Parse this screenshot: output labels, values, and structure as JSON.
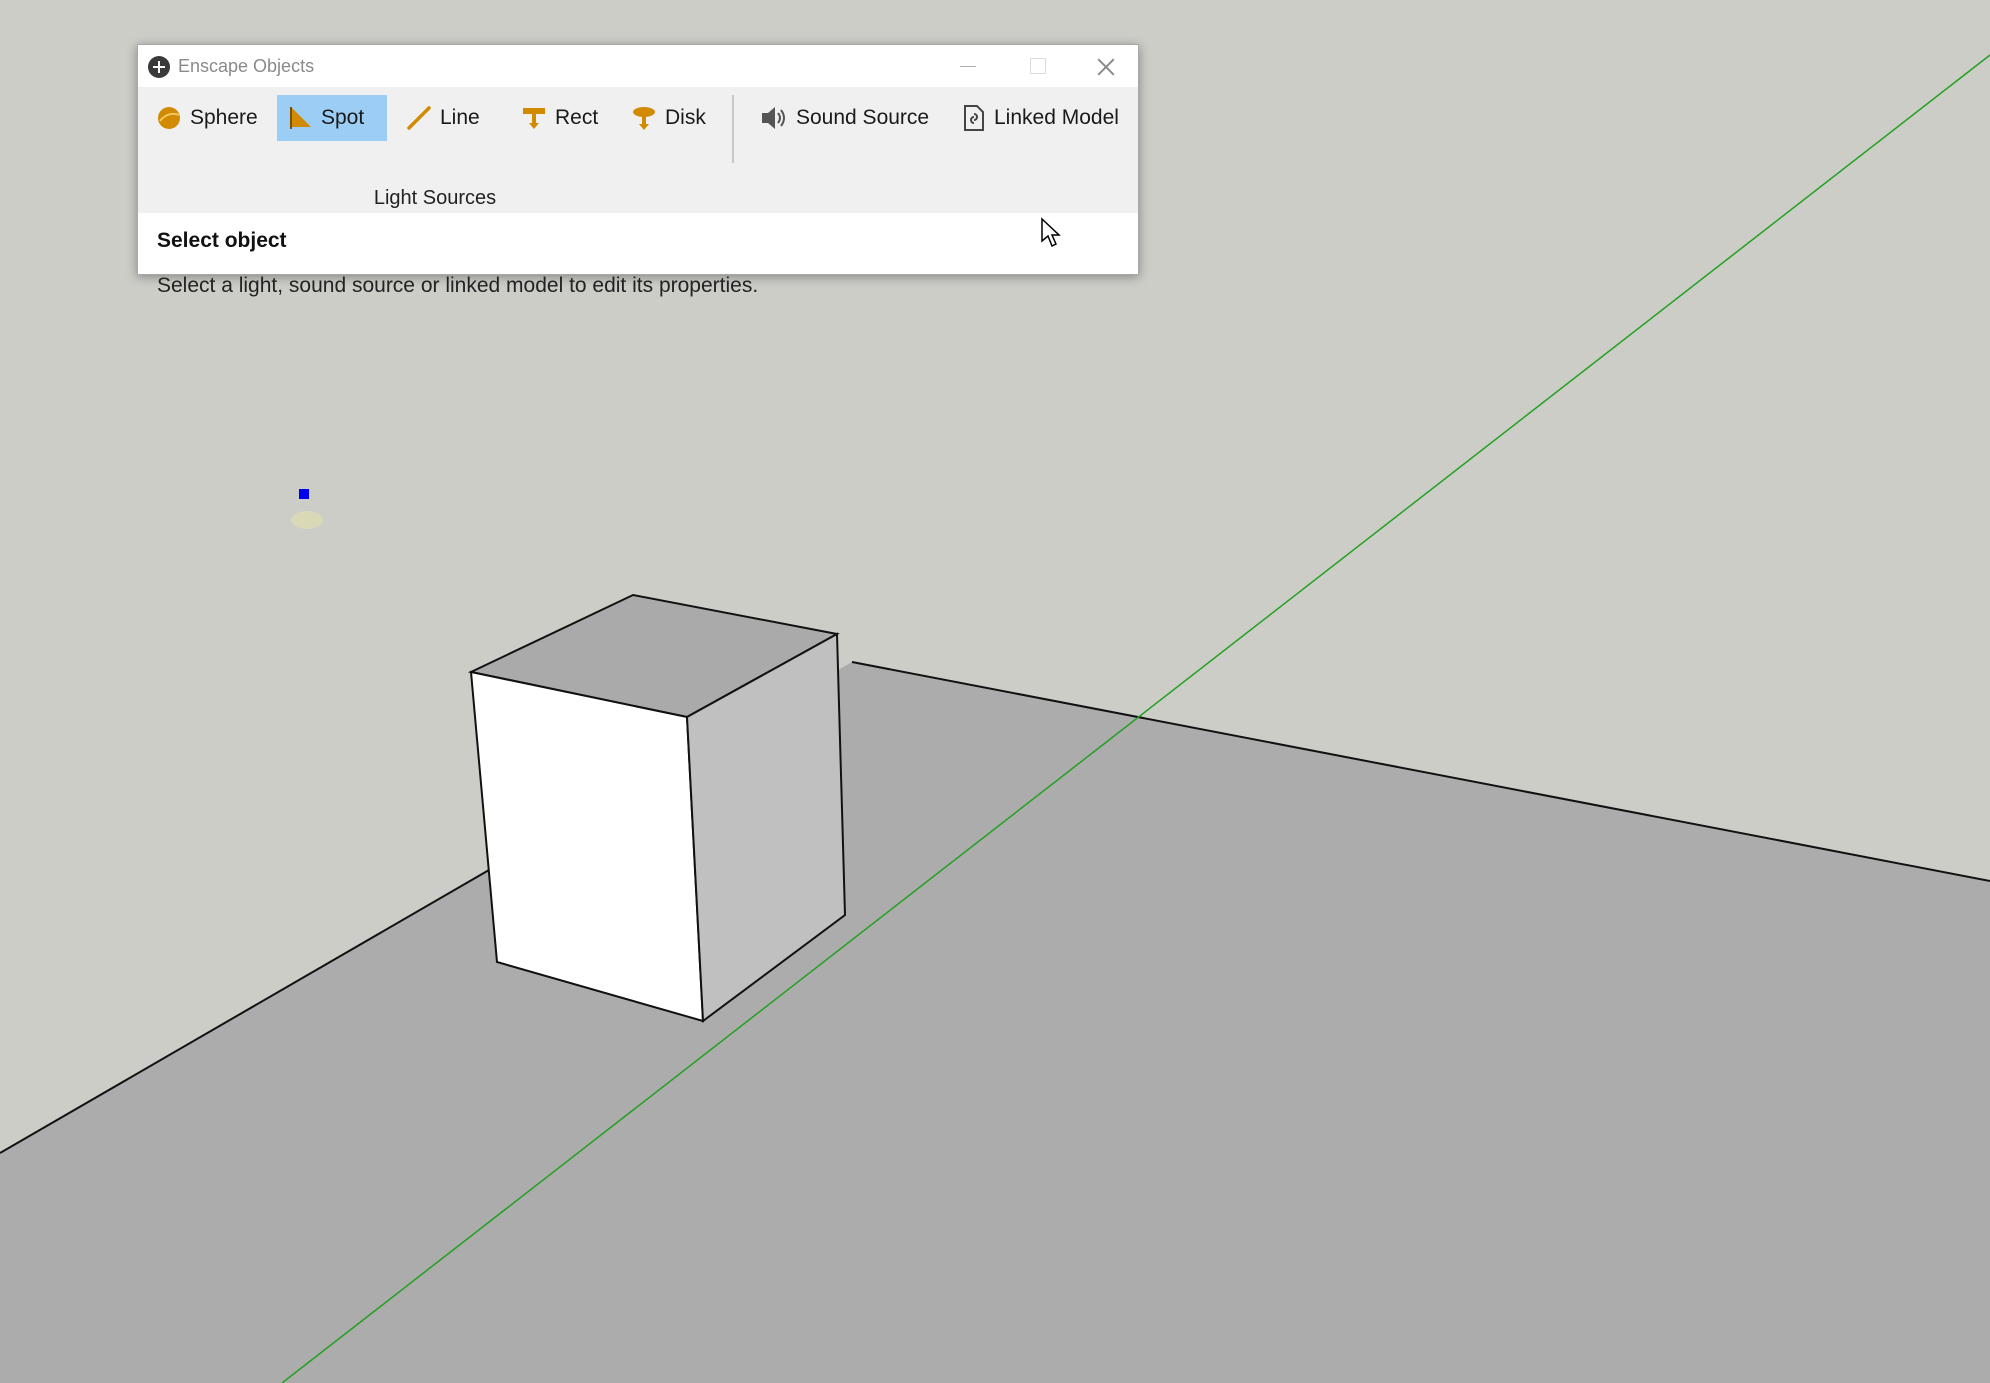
{
  "window": {
    "title": "Enscape Objects",
    "logo_icon": "enscape-plus-icon",
    "controls": [
      "minimize-icon",
      "maximize-icon",
      "close-icon"
    ]
  },
  "toolbar": {
    "light_sources_label": "Light Sources",
    "buttons": [
      {
        "label": "Sphere",
        "icon": "sphere-light-icon",
        "active": false
      },
      {
        "label": "Spot",
        "icon": "spot-light-icon",
        "active": true
      },
      {
        "label": "Line",
        "icon": "line-light-icon",
        "active": false
      },
      {
        "label": "Rect",
        "icon": "rect-light-icon",
        "active": false
      },
      {
        "label": "Disk",
        "icon": "disk-light-icon",
        "active": false
      },
      {
        "label": "Sound Source",
        "icon": "speaker-icon",
        "active": false
      },
      {
        "label": "Linked Model",
        "icon": "linked-model-icon",
        "active": false
      }
    ]
  },
  "panel": {
    "heading": "Select object",
    "description": "Select a light, sound source or linked model to edit its properties."
  },
  "colors": {
    "sky": "#cdcdc8",
    "ground": "#acacac",
    "axis_green": "#22a022",
    "active_button": "#9ccdf5",
    "light_icon": "#d28a00"
  }
}
